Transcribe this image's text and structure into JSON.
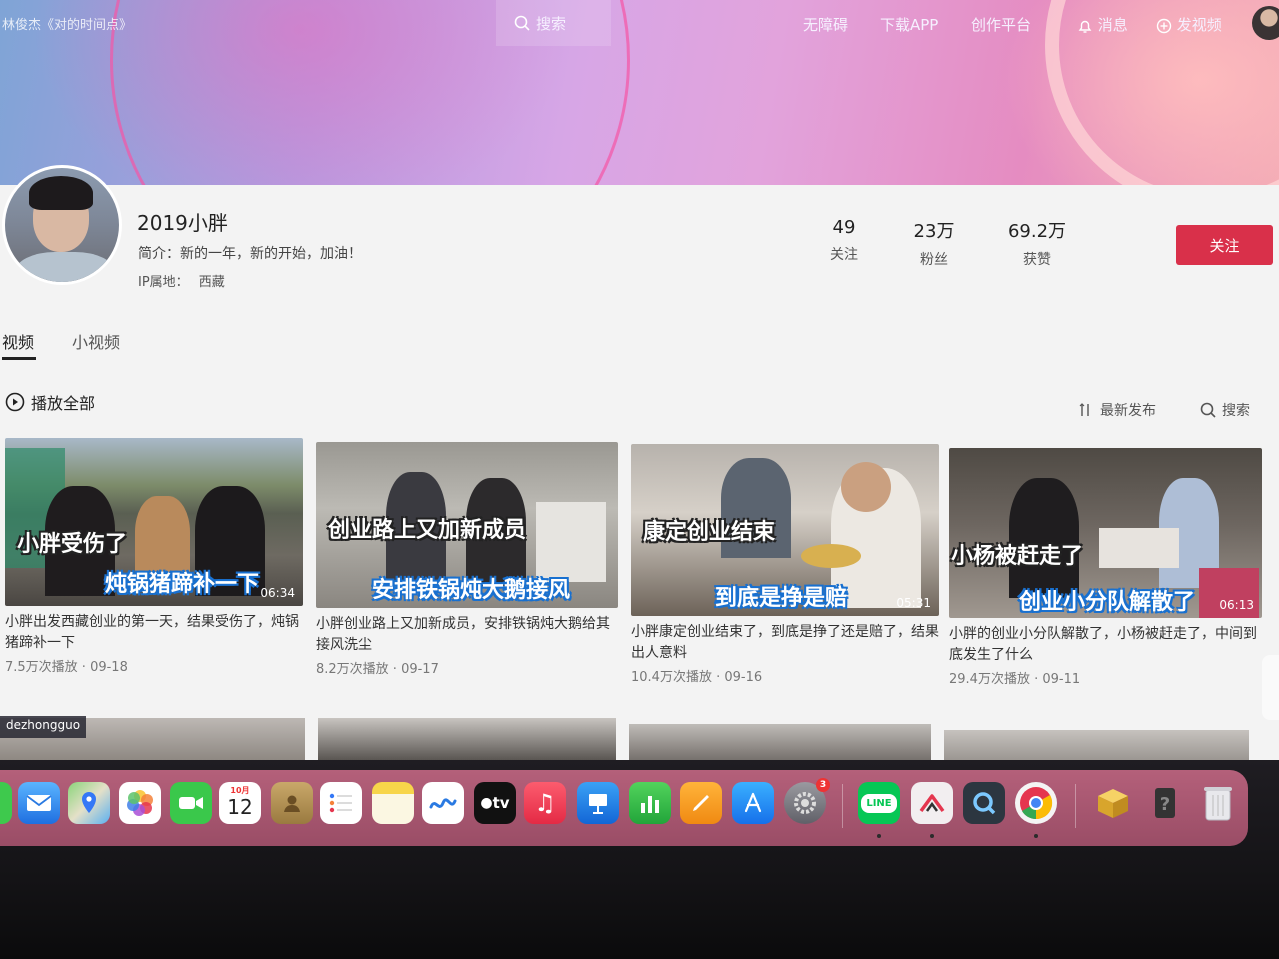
{
  "topbar": {
    "song": "林俊杰《对的时间点》",
    "search_label": "搜索",
    "links": [
      "无障碍",
      "下载APP",
      "创作平台"
    ],
    "messages": "消息",
    "upload": "发视频"
  },
  "profile": {
    "name": "2019小胖",
    "bio": "简介：新的一年，新的开始，加油！",
    "ip_label": "IP属地：",
    "ip_value": "西藏",
    "stats": [
      {
        "num": "49",
        "label": "关注"
      },
      {
        "num": "23万",
        "label": "粉丝"
      },
      {
        "num": "69.2万",
        "label": "获赞"
      }
    ],
    "follow_label": "关注"
  },
  "tabs": [
    "视频",
    "小视频"
  ],
  "play_all": "播放全部",
  "sort_label": "最新发布",
  "search2_label": "搜索",
  "videos": [
    {
      "cap1": "小胖受伤了",
      "cap2": "炖锅猪蹄补一下",
      "duration": "06:34",
      "title": "小胖出发西藏创业的第一天，结果受伤了，炖锅猪蹄补一下",
      "meta": "7.5万次播放 · 09-18"
    },
    {
      "cap1": "创业路上又加新成员",
      "cap2": "安排铁锅炖大鹅接风",
      "duration": "",
      "title": "小胖创业路上又加新成员，安排铁锅炖大鹅给其接风洗尘",
      "meta": "8.2万次播放 · 09-17"
    },
    {
      "cap1": "康定创业结束",
      "cap2": "到底是挣是赔",
      "duration": "05:31",
      "title": "小胖康定创业结束了，到底是挣了还是赔了，结果出人意料",
      "meta": "10.4万次播放 · 09-16"
    },
    {
      "cap1": "小杨被赶走了",
      "cap2": "创业小分队解散了",
      "duration": "06:13",
      "title": "小胖的创业小分队解散了，小杨被赶走了，中间到底发生了什么",
      "meta": "29.4万次播放 · 09-11"
    }
  ],
  "row2_tag": "dezhongguo",
  "dock": {
    "calendar_month": "10月",
    "calendar_day": "12",
    "appletv_label": "tv",
    "line_label": "LINE",
    "settings_badge": "3"
  }
}
